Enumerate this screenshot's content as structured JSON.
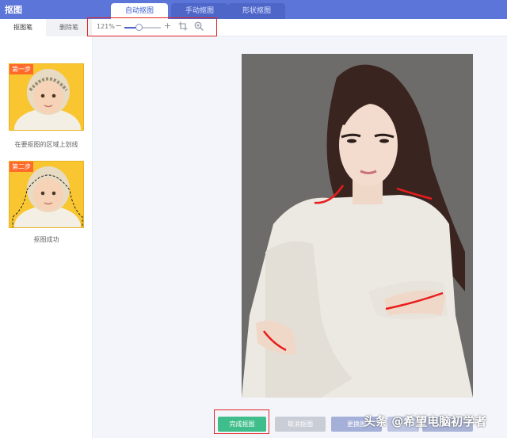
{
  "app": {
    "title": "抠图"
  },
  "tabs": [
    {
      "label": "自动抠图",
      "active": true
    },
    {
      "label": "手动抠图",
      "active": false
    },
    {
      "label": "形状抠图",
      "active": false
    }
  ],
  "side_tools": [
    {
      "label": "抠图笔",
      "active": true
    },
    {
      "label": "删除笔",
      "active": false
    }
  ],
  "zoom": {
    "value_text": "121%",
    "level_fraction": 0.4
  },
  "steps": [
    {
      "badge": "第一步",
      "caption": "在要抠图的区域上划线"
    },
    {
      "badge": "第二步",
      "caption": "抠图成功"
    }
  ],
  "buttons": {
    "done": "完成抠图",
    "cancel": "取消抠图",
    "change": "更换图"
  },
  "watermark": "头条 @希望电脑初学者",
  "colors": {
    "accent": "#5b75d8",
    "done_button": "#3fbe8b",
    "highlight_box": "#e02424",
    "step_badge": "#ff6a2a"
  }
}
